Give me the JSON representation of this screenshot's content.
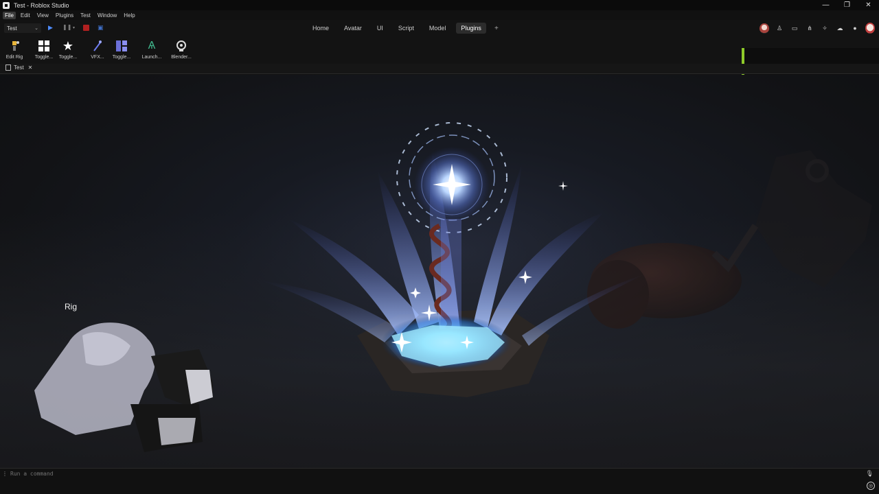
{
  "window": {
    "title": "Test - Roblox Studio",
    "controls": [
      "—",
      "❐",
      "✕"
    ]
  },
  "menu": {
    "items": [
      "File",
      "Edit",
      "View",
      "Plugins",
      "Test",
      "Window",
      "Help"
    ],
    "active": "File"
  },
  "toolbar": {
    "place_select": "Test",
    "tabs": [
      "Home",
      "Avatar",
      "UI",
      "Script",
      "Model",
      "Plugins"
    ],
    "active_tab": "Plugins",
    "add_tab": "+"
  },
  "ribbon": {
    "tools": [
      {
        "label": "Edit Rig",
        "icon": "edit-rig-icon"
      },
      {
        "label": "Toggle...",
        "icon": "grid-icon"
      },
      {
        "label": "Toggle...",
        "icon": "star-icon"
      },
      {
        "label": "VFX...",
        "icon": "vfx-wand-icon"
      },
      {
        "label": "Toggle...",
        "icon": "layout-icon"
      },
      {
        "label": "Launch...",
        "icon": "launch-icon"
      },
      {
        "label": "Blender...",
        "icon": "blender-icon"
      }
    ]
  },
  "document": {
    "tab_label": "Test",
    "close": "✕"
  },
  "viewport": {
    "rig_label": "Rig"
  },
  "command": {
    "placeholder": "Run a command"
  },
  "colors": {
    "accent_blue": "#4e8cff",
    "stop_red": "#b02020",
    "green_indicator": "#8fca2a",
    "vfx_glow": "#7fc8ff"
  }
}
